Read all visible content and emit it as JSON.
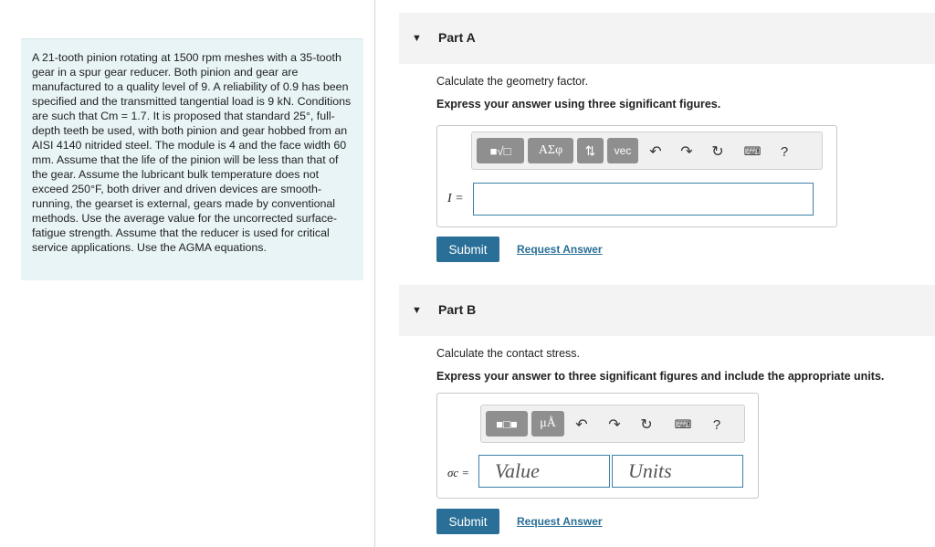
{
  "problem": {
    "text": "A 21-tooth pinion rotating at 1500 rpm meshes with a 35-tooth gear in a spur gear reducer. Both pinion and gear are manufactured to a quality level of 9. A reliability of 0.9 has been specified and the transmitted tangential load is 9 kN. Conditions are such that Cm = 1.7. It is proposed that standard 25°, full-depth teeth be used, with both pinion and gear hobbed from an AISI 4140 nitrided steel. The module is 4 and the face width 60 mm. Assume that the life of the pinion will be less than that of the gear. Assume the lubricant bulk temperature does not exceed 250°F, both driver and driven devices are smooth-running, the gearset is external, gears made by conventional methods. Use the average value for the uncorrected surface-fatigue strength. Assume that the reducer is used for critical service applications. Use the AGMA equations."
  },
  "partA": {
    "title": "Part A",
    "prompt": "Calculate the geometry factor.",
    "instruction": "Express your answer using three significant figures.",
    "toolbar": {
      "templates_icon": "templates-icon",
      "greek": "ΑΣφ",
      "arrows": "⇅",
      "vec": "vec",
      "undo_icon": "undo-icon",
      "redo_icon": "redo-icon",
      "reset_icon": "reset-icon",
      "keyboard_icon": "keyboard-icon",
      "help": "?"
    },
    "label": "I =",
    "value": "",
    "submit": "Submit",
    "request": "Request Answer"
  },
  "partB": {
    "title": "Part B",
    "prompt": "Calculate the contact stress.",
    "instruction": "Express your answer to three significant figures and include the appropriate units.",
    "toolbar": {
      "templates_icon": "templates-icon",
      "units": "μÅ",
      "undo_icon": "undo-icon",
      "redo_icon": "redo-icon",
      "reset_icon": "reset-icon",
      "keyboard_icon": "keyboard-icon",
      "help": "?"
    },
    "label": "σc =",
    "value_placeholder": "Value",
    "units_placeholder": "Units",
    "submit": "Submit",
    "request": "Request Answer"
  }
}
